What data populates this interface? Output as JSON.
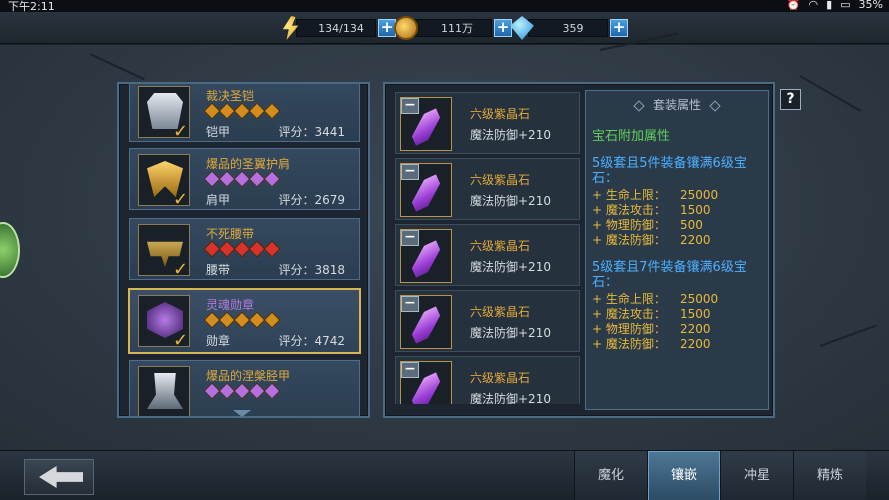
{
  "status_bar": {
    "time": "下午2:11",
    "battery": "35%"
  },
  "resources": {
    "energy": "134/134",
    "gold": "111万",
    "diamond": "359",
    "plus_label": "+"
  },
  "equipment": [
    {
      "name": "裁决圣铠",
      "type": "铠甲",
      "score": "评分：3441",
      "name_color": "orange",
      "gem_color": "#d38c1e",
      "icon": "chest-armor-icon"
    },
    {
      "name": "爆品的圣翼护肩",
      "type": "肩甲",
      "score": "评分：2679",
      "name_color": "orange",
      "gem_color": "#b56fe0",
      "icon": "shoulder-wing-icon"
    },
    {
      "name": "不死腰带",
      "type": "腰带",
      "score": "评分：3818",
      "name_color": "orange",
      "gem_color": "#d8322a",
      "icon": "belt-icon"
    },
    {
      "name": "灵魂勋章",
      "type": "勋章",
      "score": "评分：4742",
      "name_color": "purple",
      "gem_color": "#d38c1e",
      "icon": "medal-icon",
      "selected": true
    },
    {
      "name": "爆品的涅槃胫甲",
      "type": "",
      "score": "",
      "name_color": "orange",
      "gem_color": "#b56fe0",
      "icon": "greaves-icon"
    }
  ],
  "inlaid_gems": [
    {
      "name": "六级紫晶石",
      "stat": "魔法防御+210"
    },
    {
      "name": "六级紫晶石",
      "stat": "魔法防御+210"
    },
    {
      "name": "六级紫晶石",
      "stat": "魔法防御+210"
    },
    {
      "name": "六级紫晶石",
      "stat": "魔法防御+210"
    },
    {
      "name": "六级紫晶石",
      "stat": "魔法防御+210"
    }
  ],
  "set_attributes": {
    "header": "套装属性",
    "subtitle": "宝石附加属性",
    "tier5": {
      "title": "5级套且5件装备镶满6级宝石：",
      "stats": [
        {
          "k": "+ 生命上限：",
          "v": "25000"
        },
        {
          "k": "+ 魔法攻击：",
          "v": "1500"
        },
        {
          "k": "+ 物理防御：",
          "v": "500"
        },
        {
          "k": "+ 魔法防御：",
          "v": "2200"
        }
      ]
    },
    "tier7": {
      "title": "5级套且7件装备镶满6级宝石：",
      "stats": [
        {
          "k": "+ 生命上限：",
          "v": "25000"
        },
        {
          "k": "+ 魔法攻击：",
          "v": "1500"
        },
        {
          "k": "+ 物理防御：",
          "v": "2200"
        },
        {
          "k": "+ 魔法防御：",
          "v": "2200"
        }
      ]
    }
  },
  "help_label": "?",
  "tabs": [
    {
      "label": "魔化",
      "active": false
    },
    {
      "label": "镶嵌",
      "active": true
    },
    {
      "label": "冲星",
      "active": false
    },
    {
      "label": "精炼",
      "active": false
    }
  ],
  "colors": {
    "accent_gold": "#e1a93a",
    "accent_purple": "#b47be0",
    "green_text": "#5fd05a",
    "blue_text": "#4ab0ff",
    "active_tab": "#4f7796"
  }
}
